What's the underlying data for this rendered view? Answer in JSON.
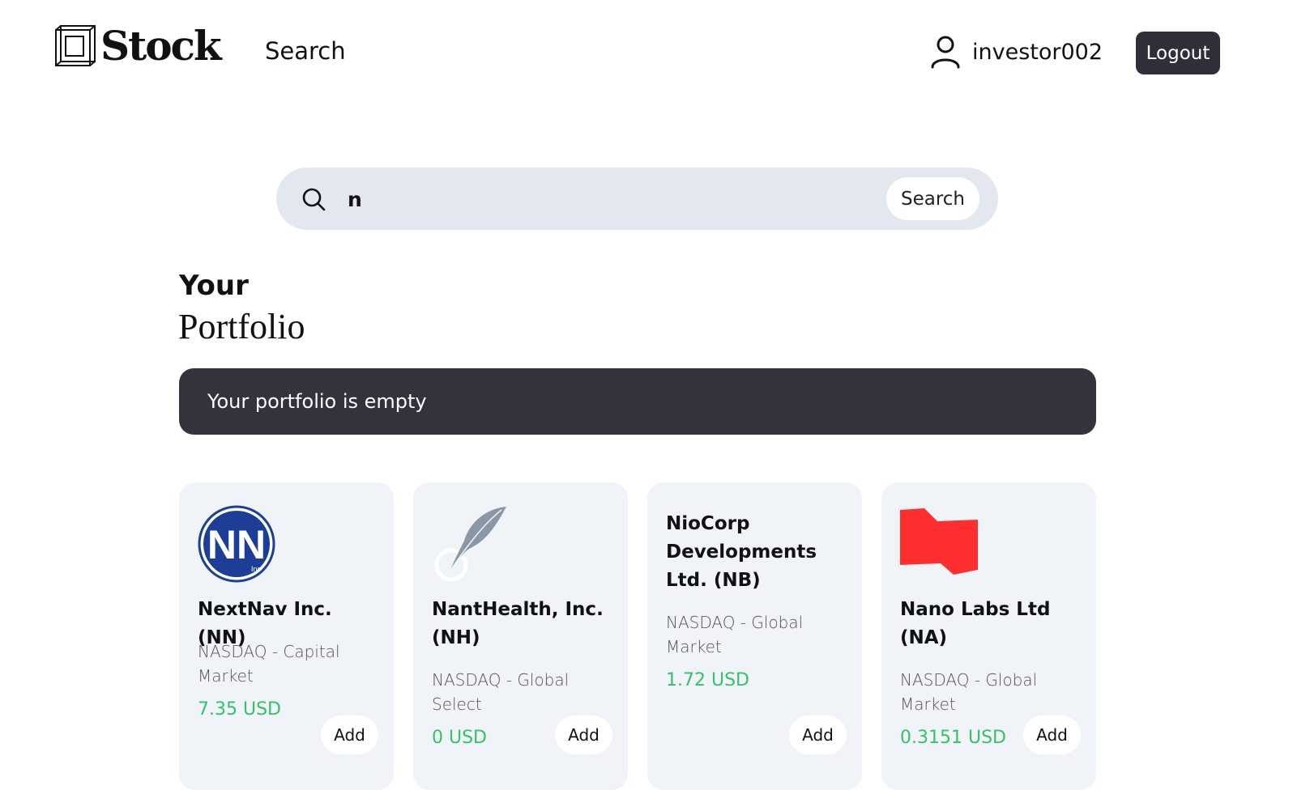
{
  "header": {
    "logo_text": "Stock",
    "nav_search": "Search",
    "username": "investor002",
    "logout_label": "Logout"
  },
  "search": {
    "query": "n",
    "button_label": "Search"
  },
  "portfolio": {
    "title_line1": "Your",
    "title_line2": "Portfolio",
    "empty_message": "Your portfolio is empty"
  },
  "results": [
    {
      "name": "NextNav Inc. (NN)",
      "exchange": "NASDAQ - Capital Market",
      "price": "7.35 USD",
      "add_label": "Add",
      "logo": "nn-logo"
    },
    {
      "name": "NantHealth, Inc. (NH)",
      "exchange": "NASDAQ - Global Select",
      "price": "0 USD",
      "add_label": "Add",
      "logo": "feather-logo"
    },
    {
      "name": "NioCorp Developments Ltd. (NB)",
      "exchange": "NASDAQ - Global Market",
      "price": "1.72 USD",
      "add_label": "Add",
      "logo": ""
    },
    {
      "name": "Nano Labs Ltd (NA)",
      "exchange": "NASDAQ - Global Market",
      "price": "0.3151 USD",
      "add_label": "Add",
      "logo": "red-flag-logo"
    }
  ],
  "colors": {
    "price_green": "#34c26a",
    "dark": "#33323d",
    "search_bg": "#e3e8f0",
    "card_bg": "#f0f3f7"
  }
}
